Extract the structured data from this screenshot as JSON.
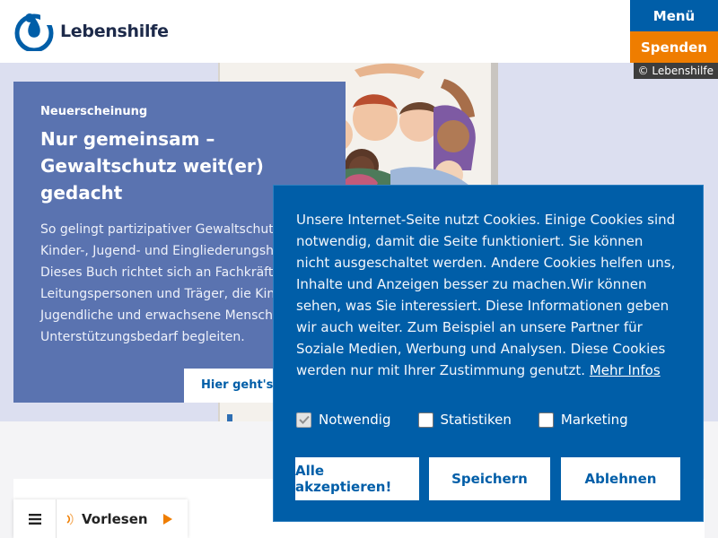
{
  "header": {
    "logo_text": "Lebenshilfe",
    "menu_label": "Menü",
    "donate_label": "Spenden",
    "colors": {
      "primary": "#005ea8",
      "donate": "#ef7d00"
    }
  },
  "hero": {
    "copyright": "© Lebenshilfe",
    "kicker": "Neuerscheinung",
    "title": "Nur gemeinsam – Gewaltschutz weit(er) gedacht",
    "text": "So gelingt partizipativer Gewaltschutz in Kinder-, Jugend- und Eingliederungshilfe. Dieses Buch richtet sich an Fachkräfte, Leitungspersonen und Träger, die Kinder, Jugendliche und erwachsene Menschen mit Unterstützungsbedarf begleiten.",
    "link_label": "Hier geht's zum Buch",
    "teaser_color": "#5a73b0"
  },
  "reader": {
    "label": "Vorlesen",
    "icons": [
      "hamburger-icon",
      "sound-wave-icon",
      "play-icon"
    ]
  },
  "cookie": {
    "text": "Unsere Internet-Seite nutzt Cookies. Einige Cookies sind notwendig, damit die Seite funktioniert. Sie können nicht ausgeschaltet werden. Andere Cookies helfen uns, Inhalte und Anzeigen besser zu machen.Wir können sehen, was Sie interessiert. Diese Informationen geben wir auch weiter. Zum Beispiel an unsere Partner für Soziale Medien, Werbung und Analysen. Diese Cookies werden nur mit Ihrer Zustimmung genutzt.",
    "more_link": "Mehr Infos",
    "options": [
      {
        "label": "Notwendig",
        "checked": true,
        "disabled": true
      },
      {
        "label": "Statistiken",
        "checked": false,
        "disabled": false
      },
      {
        "label": "Marketing",
        "checked": false,
        "disabled": false
      }
    ],
    "buttons": {
      "accept_all": "Alle akzeptieren!",
      "save": "Speichern",
      "decline": "Ablehnen"
    }
  }
}
